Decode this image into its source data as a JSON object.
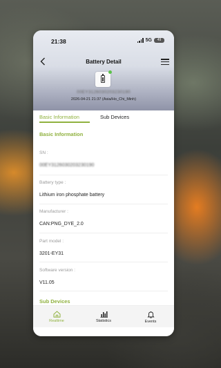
{
  "status_bar": {
    "time": "21:38",
    "network": "5G",
    "battery": "49"
  },
  "nav": {
    "title": "Battery Detail"
  },
  "device": {
    "sn": "00EY3126030203230190",
    "timestamp": "2026-04-21 21:37 (Asia/Ho_Chi_Minh)"
  },
  "tabs": {
    "basic": "Basic Information",
    "sub": "Sub Devices"
  },
  "sections": {
    "basic_heading": "Basic Information",
    "sub_heading": "Sub Devices"
  },
  "fields": [
    {
      "label": "SN :",
      "value": "00EY3126030203230190"
    },
    {
      "label": "Battery type :",
      "value": "Lithium iron phosphate battery"
    },
    {
      "label": "Manufacturer :",
      "value": "CAN:PNG_DYE_2.0"
    },
    {
      "label": "Part model :",
      "value": "3201-EY31"
    },
    {
      "label": "Software version :",
      "value": "V11.05"
    }
  ],
  "bottom_nav": {
    "realtime": "Realtime",
    "statistics": "Statistics",
    "events": "Events"
  },
  "colors": {
    "accent": "#8fb13e",
    "online": "#5cc24c"
  }
}
